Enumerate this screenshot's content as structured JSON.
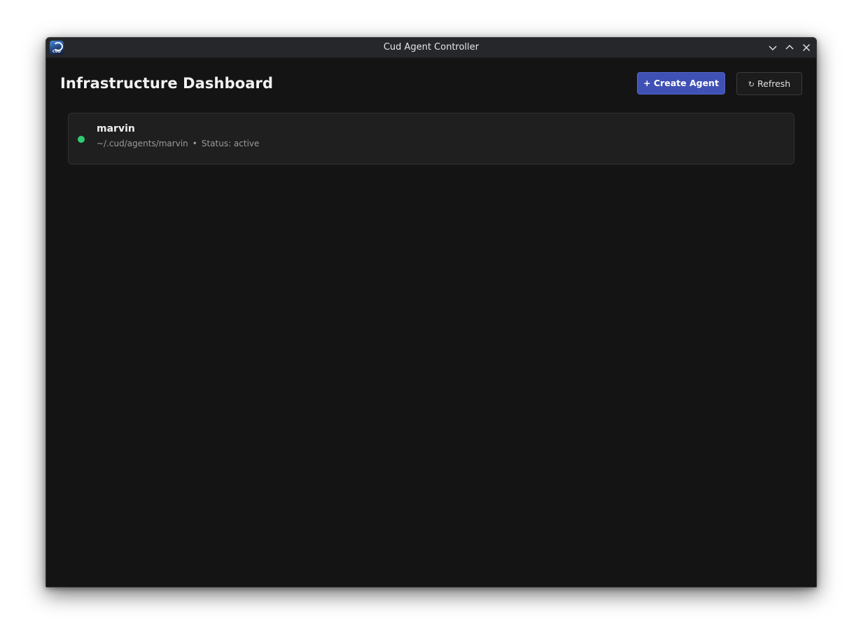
{
  "window": {
    "title": "Cud Agent Controller",
    "icon": "cud-app-icon",
    "icon_text": "CUD",
    "controls": [
      "chevron-down-icon",
      "chevron-up-icon",
      "close-icon"
    ]
  },
  "header": {
    "title": "Infrastructure Dashboard",
    "create_button": "+ Create Agent",
    "refresh_icon": "↻",
    "refresh_button": "Refresh"
  },
  "agents": [
    {
      "name": "marvin",
      "path": "~/.cud/agents/marvin",
      "separator": "•",
      "status_label": "Status: active",
      "status_color": "#2ecc71"
    }
  ],
  "colors": {
    "accent": "#3f51b5",
    "background": "#141414",
    "card": "#1f1f1f",
    "status_active": "#2ecc71"
  }
}
